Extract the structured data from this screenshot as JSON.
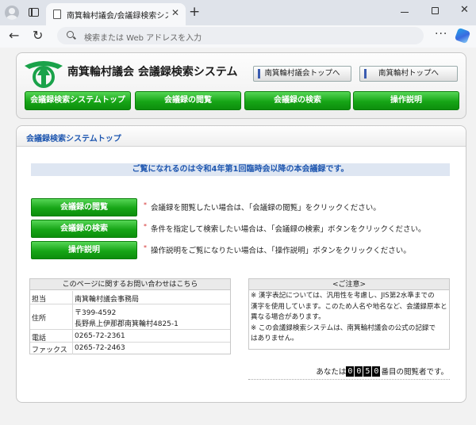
{
  "browser": {
    "tab_title": "南箕輪村議会/会議録検索システム",
    "tab_close": "✕",
    "new_tab": "+",
    "address_placeholder": "検索または Web アドレスを入力",
    "back": "←",
    "reload": "↻",
    "menu": "···",
    "close": "✕"
  },
  "header": {
    "site_title": "南箕輪村議会 会議録検索システム",
    "toplinks": [
      "南箕輪村議会トップへ",
      "南箕輪村トップへ"
    ],
    "menu": [
      "会議録検索システムトップ",
      "会議録の閲覧",
      "会議録の検索",
      "操作説明"
    ]
  },
  "main": {
    "section_title": "会議録検索システムトップ",
    "notice": "ご覧になれるのは令和4年第1回臨時会以降の本会議録です。",
    "actions": [
      {
        "label": "会議録の閲覧",
        "desc": "会議録を閲覧したい場合は、「会議録の閲覧」をクリックください。"
      },
      {
        "label": "会議録の検索",
        "desc": "条件を指定して検索したい場合は、「会議録の検索」ボタンをクリックください。"
      },
      {
        "label": "操作説明",
        "desc": "操作説明をご覧になりたい場合は、「操作説明」ボタンをクリックください。"
      }
    ],
    "star": "*"
  },
  "contact": {
    "heading": "このページに関するお問い合わせはこちら",
    "rows": [
      {
        "label": "担当",
        "value": "南箕輪村議会事務局"
      },
      {
        "label": "住所",
        "value1": "〒399-4592",
        "value2": "長野県上伊那郡南箕輪村4825-1"
      },
      {
        "label": "電話",
        "value": "0265-72-2361"
      },
      {
        "label": "ファックス",
        "value": "0265-72-2463"
      }
    ]
  },
  "caution": {
    "heading": "<ご注意>",
    "lines": [
      "※ 漢字表記については、汎用性を考慮し、JIS第2水準までの",
      "漢字を使用しています。このため人名や地名など、会議録原本と",
      "異なる場合があります。",
      "※ この会議録検索システムは、南箕輪村議会の公式の記録で",
      "はありません。"
    ]
  },
  "counter": {
    "prefix": "あなたは",
    "digits": [
      "0",
      "0",
      "5",
      "0"
    ],
    "suffix": "番目の閲覧者です。"
  },
  "colors": {
    "accent_green": "#16a516",
    "title_blue": "#1f57b0",
    "notice_bg": "#dee6f2"
  }
}
